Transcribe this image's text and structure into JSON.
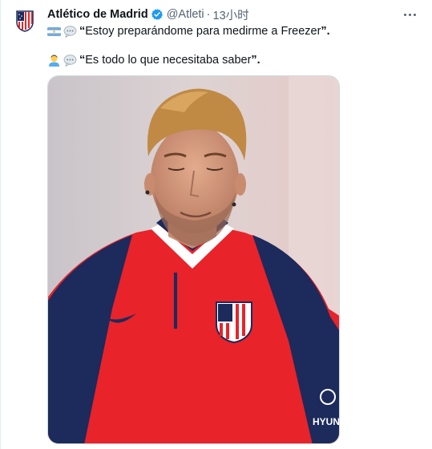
{
  "account": {
    "display_name": "Atlético de Madrid",
    "handle": "@Atleti",
    "separator": "·",
    "timestamp": "13小时"
  },
  "tweet": {
    "line1": {
      "flag_icon": "argentina-flag-emoji",
      "bubble_icon": "speech-bubble-emoji",
      "open_quote": "“",
      "text": "Estoy preparándome para medirme a Freezer",
      "close_quote": "”."
    },
    "line2": {
      "person_icon": "person-emoji",
      "bubble_icon": "speech-bubble-emoji",
      "open_quote": "“",
      "text": "Es todo lo que necesitaba saber",
      "close_quote": "”."
    }
  },
  "media": {
    "type": "photo",
    "jersey_sponsor": "HYUN",
    "colors": {
      "jersey_red": "#e8232a",
      "jersey_navy": "#1c2a5c",
      "background": "#d9cfd0",
      "hair": "#c08a45"
    }
  },
  "colors": {
    "verified_blue": "#1d9bf0",
    "secondary_text": "#536471",
    "border": "#cfd9de"
  }
}
